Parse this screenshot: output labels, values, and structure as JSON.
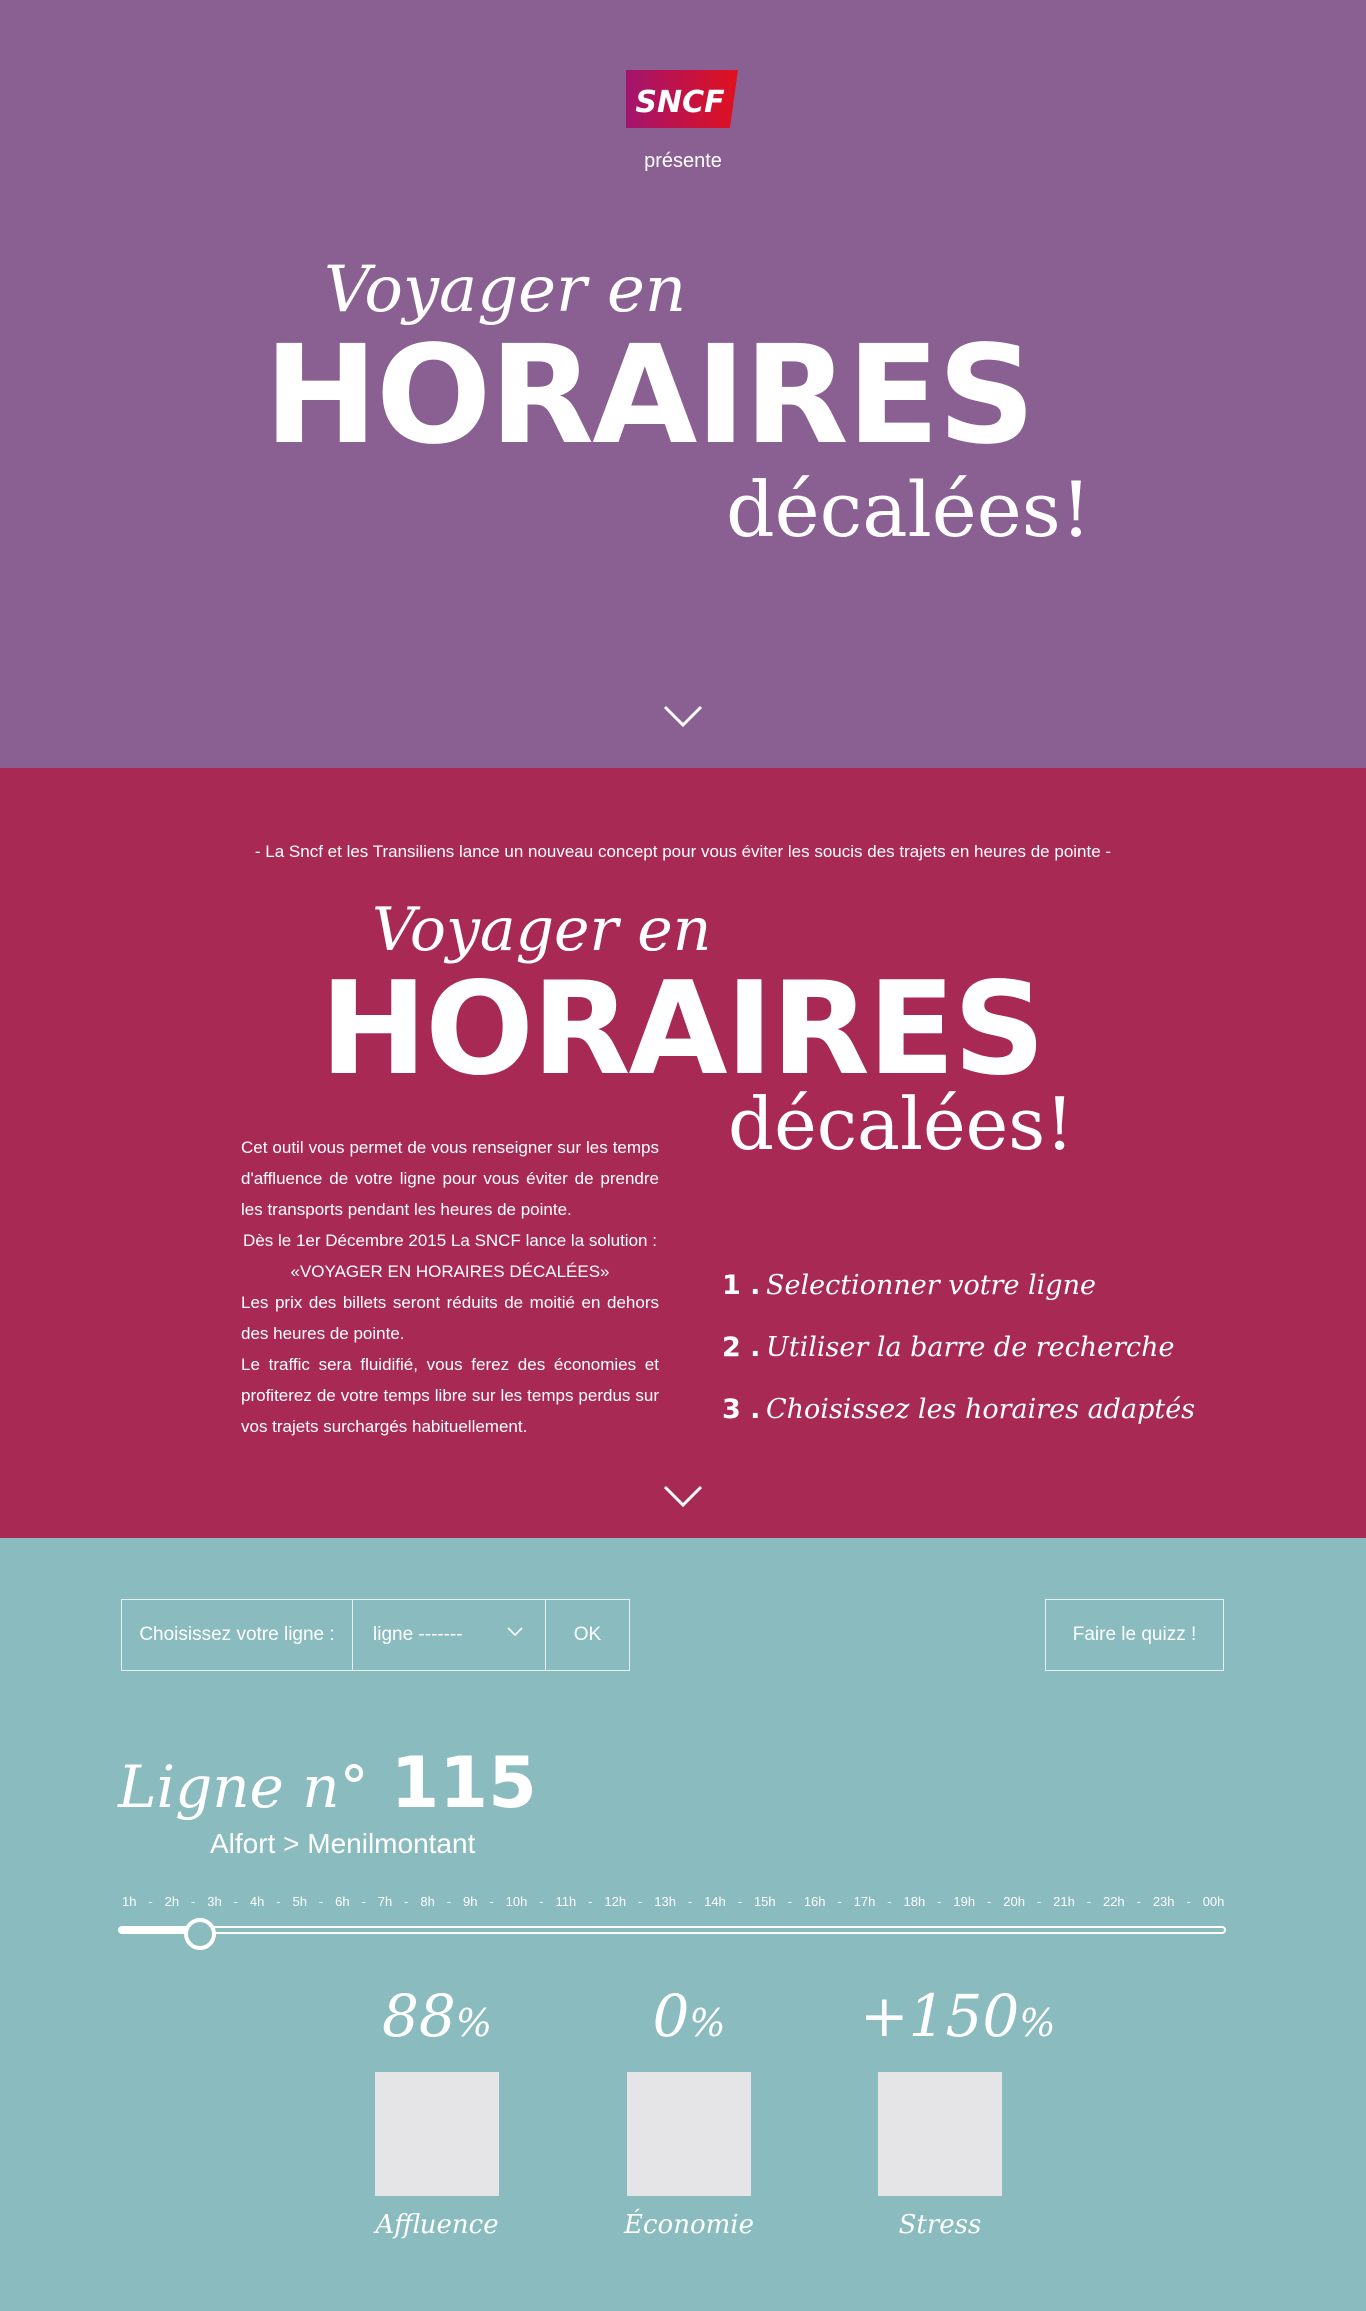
{
  "brand": {
    "logo_text": "SNCF",
    "presente": "présente"
  },
  "hero": {
    "voyager": "Voyager en",
    "horaires": "HORAIRES",
    "decalees": "décalées!"
  },
  "intro": {
    "caption": "- La Sncf et les Transiliens lance un nouveau concept pour vous éviter les soucis des trajets en heures de pointe -",
    "voyager": "Voyager en",
    "horaires": "HORAIRES",
    "decalees": "décalées!",
    "body": [
      "Cet outil vous permet de vous renseigner sur les temps d'affluence de votre ligne pour vous éviter de prendre les transports pendant les heures de pointe.",
      "Dès le 1er Décembre 2015 La SNCF lance la solution :",
      "«VOYAGER EN HORAIRES DÉCALÉES»",
      "Les prix des billets seront réduits de moitié en dehors des heures de pointe.",
      "Le traffic sera fluidifié, vous ferez des économies et profiterez de votre temps libre sur les temps perdus sur vos trajets surchargés habituellement."
    ],
    "steps": [
      {
        "num": "1 .",
        "text": "Selectionner votre ligne"
      },
      {
        "num": "2 .",
        "text": "Utiliser la barre de recherche"
      },
      {
        "num": "3 .",
        "text": "Choisissez les horaires adaptés"
      }
    ]
  },
  "tool": {
    "select_label": "Choisissez votre ligne :",
    "select_value": "ligne -------",
    "ok": "OK",
    "quiz": "Faire le quizz !",
    "ligne_word": "Ligne n°",
    "ligne_number": "115",
    "route": "Alfort > Menilmontant",
    "hours": [
      "1h",
      "-",
      "2h",
      "-",
      "3h",
      "-",
      "4h",
      "-",
      "5h",
      "-",
      "6h",
      "-",
      "7h",
      "-",
      "8h",
      "-",
      "9h",
      "-",
      "10h",
      "-",
      "11h",
      "-",
      "12h",
      "-",
      "13h",
      "-",
      "14h",
      "-",
      "15h",
      "-",
      "16h",
      "-",
      "17h",
      "-",
      "18h",
      "-",
      "19h",
      "-",
      "20h",
      "-",
      "21h",
      "-",
      "22h",
      "-",
      "23h",
      "-",
      "00h"
    ],
    "slider_value_fraction": 0.074,
    "stats": [
      {
        "value": "88",
        "unit": "%",
        "label": "Affluence"
      },
      {
        "value": "0",
        "unit": "%",
        "label": "Économie"
      },
      {
        "value": "+150",
        "unit": "%",
        "label": "Stress"
      }
    ]
  },
  "colors": {
    "hero_bg": "#8a6093",
    "intro_bg": "#a82a54",
    "tool_bg": "#89bbbf",
    "logo_red": "#e0111f",
    "logo_purple": "#a3146e"
  }
}
